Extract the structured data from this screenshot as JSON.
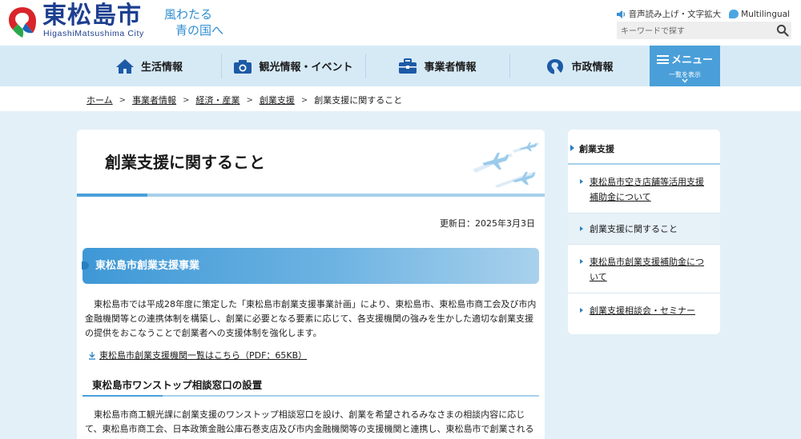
{
  "header": {
    "logo_title": "東松島市",
    "logo_sub": "HigashiMatsushima City",
    "slogan_line1": "風わたる",
    "slogan_line2": "青の国へ",
    "util_speech": "音声読み上げ・文字拡大",
    "util_multilingual": "Multilingual",
    "search_placeholder": "キーワードで探す"
  },
  "nav": {
    "items": [
      {
        "label": "生活情報",
        "icon": "house-icon"
      },
      {
        "label": "観光情報・イベント",
        "icon": "camera-icon"
      },
      {
        "label": "事業者情報",
        "icon": "briefcase-icon"
      },
      {
        "label": "市政情報",
        "icon": "city-emblem-icon"
      }
    ],
    "menu_label": "メニュー",
    "menu_sub": "一覧を表示"
  },
  "breadcrumb": [
    "ホーム",
    "事業者情報",
    "経済・産業",
    "創業支援",
    "創業支援に関すること"
  ],
  "main": {
    "title": "創業支援に関すること",
    "updated": "更新日：2025年3月3日",
    "h2": "東松島市創業支援事業",
    "p1": "東松島市では平成28年度に策定した「東松島市創業支援事業計画」により、東松島市、東松島市商工会及び市内金融機関等との連携体制を構築し、創業に必要となる要素に応じて、各支援機関の強みを生かした適切な創業支援の提供をおこなうことで創業者への支援体制を強化します。",
    "link": "東松島市創業支援機関一覧はこちら（PDF：65KB）",
    "h3": "東松島市ワンストップ相談窓口の設置",
    "p2": "東松島市商工観光課に創業支援のワンストップ相談窓口を設け、創業を希望されるみなさまの相談内容に応じて、東松島市商工会、日本政策金融公庫石巻支店及び市内金融機関等の支援機関と連携し、東松島市で創業されることを支援します。"
  },
  "sidebar": {
    "heading": "創業支援",
    "items": [
      "東松島市空き店舗等活用支援補助金について",
      "創業支援に関すること",
      "東松島市創業支援補助金について",
      "創業支援相談会・セミナー"
    ]
  },
  "colors": {
    "brand_blue": "#1d3f8f",
    "accent": "#4a9fd9",
    "nav_bg": "#d6eaf6",
    "page_bg": "#e3f0f8"
  }
}
